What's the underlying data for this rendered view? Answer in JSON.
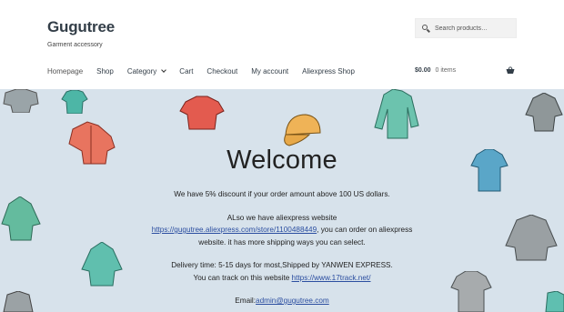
{
  "site": {
    "title": "Gugutree",
    "tagline": "Garment accessory"
  },
  "search": {
    "placeholder": "Search products…"
  },
  "nav": {
    "items": [
      {
        "label": "Homepage"
      },
      {
        "label": "Shop"
      },
      {
        "label": "Category"
      },
      {
        "label": "Cart"
      },
      {
        "label": "Checkout"
      },
      {
        "label": "My account"
      },
      {
        "label": "Aliexpress Shop"
      }
    ]
  },
  "cart": {
    "amount": "$0.00",
    "count": "0 items",
    "icon": "basket-icon"
  },
  "hero": {
    "heading": "Welcome",
    "discount_text": "We have 5% discount if your order amount above 100 US dollars.",
    "ali_intro": "ALso we have aliexpress website",
    "ali_link": "https://gugutree.aliexpress.com/store/1100488449",
    "ali_after": ", you can order on aliexpress",
    "ali_line3": "website. it has more shipping ways you can select.",
    "delivery_text": "Delivery time: 5-15 days for most,Shipped by YANWEN EXPRESS.",
    "track_before": "You can track on this website ",
    "track_link": "https://www.17track.net/",
    "email_label": "Email:",
    "email_link": "admin@gugutree.com"
  },
  "colors": {
    "hero_background": "#d7e2eb",
    "link": "#2b4ea0",
    "header_text": "#333e48"
  }
}
